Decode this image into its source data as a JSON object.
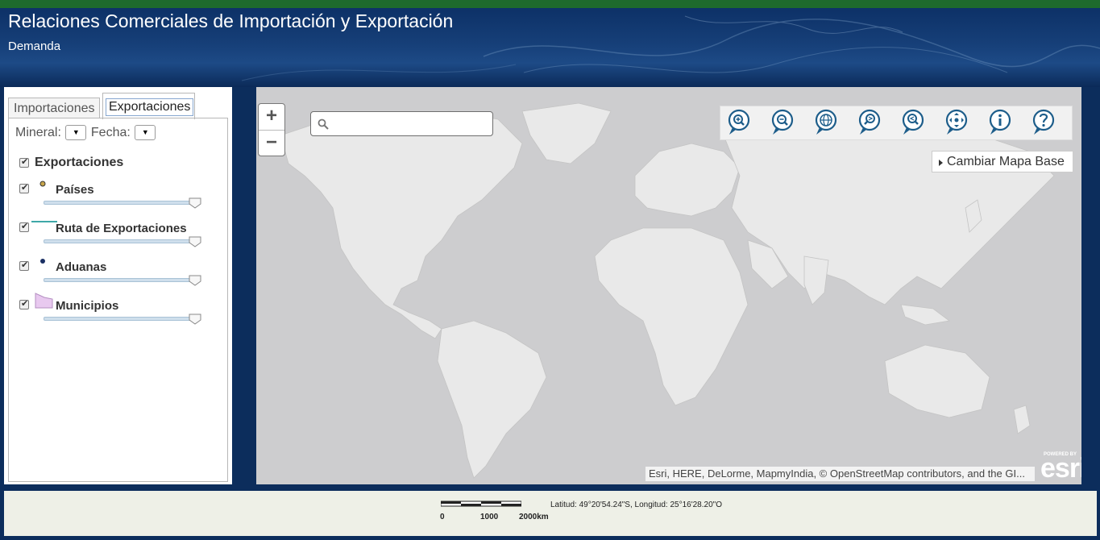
{
  "header": {
    "title": "Relaciones Comerciales de Importación y Exportación",
    "subtitle": "Demanda"
  },
  "tabs": {
    "importaciones": "Importaciones",
    "exportaciones": "Exportaciones"
  },
  "filters": {
    "mineral_label": "Mineral:",
    "fecha_label": "Fecha:"
  },
  "layers": {
    "group": "Exportaciones",
    "items": [
      {
        "label": "Países",
        "symbol": "dot",
        "color": "#c8a64b"
      },
      {
        "label": "Ruta de Exportaciones",
        "symbol": "line",
        "color": "#3fa8a8"
      },
      {
        "label": "Aduanas",
        "symbol": "dot",
        "color": "#1a2f63"
      },
      {
        "label": "Municipios",
        "symbol": "polygon",
        "color": "#e8c9ef"
      }
    ]
  },
  "map": {
    "zoom_in": "+",
    "zoom_out": "−",
    "search_value": "",
    "basemap_button": "Cambiar Mapa Base",
    "attribution": "Esri, HERE, DeLorme, MapmyIndia, © OpenStreetMap contributors, and the GI...",
    "powered_by": "POWERED BY",
    "esri_logo": "esri",
    "tools": [
      "zoom-in-tool",
      "zoom-out-tool",
      "full-extent-tool",
      "previous-extent-tool",
      "next-extent-tool",
      "pan-tool",
      "info-tool",
      "help-tool"
    ]
  },
  "footer": {
    "scale_labels": [
      "0",
      "1000",
      "2000km"
    ],
    "coordinates": "Latitud: 49°20'54.24\"S, Longitud: 25°16'28.20\"O"
  },
  "colors": {
    "topbar": "#1e6a2c",
    "header": "#0d3167",
    "map_water": "#cdcdcf",
    "map_land": "#e9e9e9",
    "tool_blue": "#1d5d8a"
  }
}
